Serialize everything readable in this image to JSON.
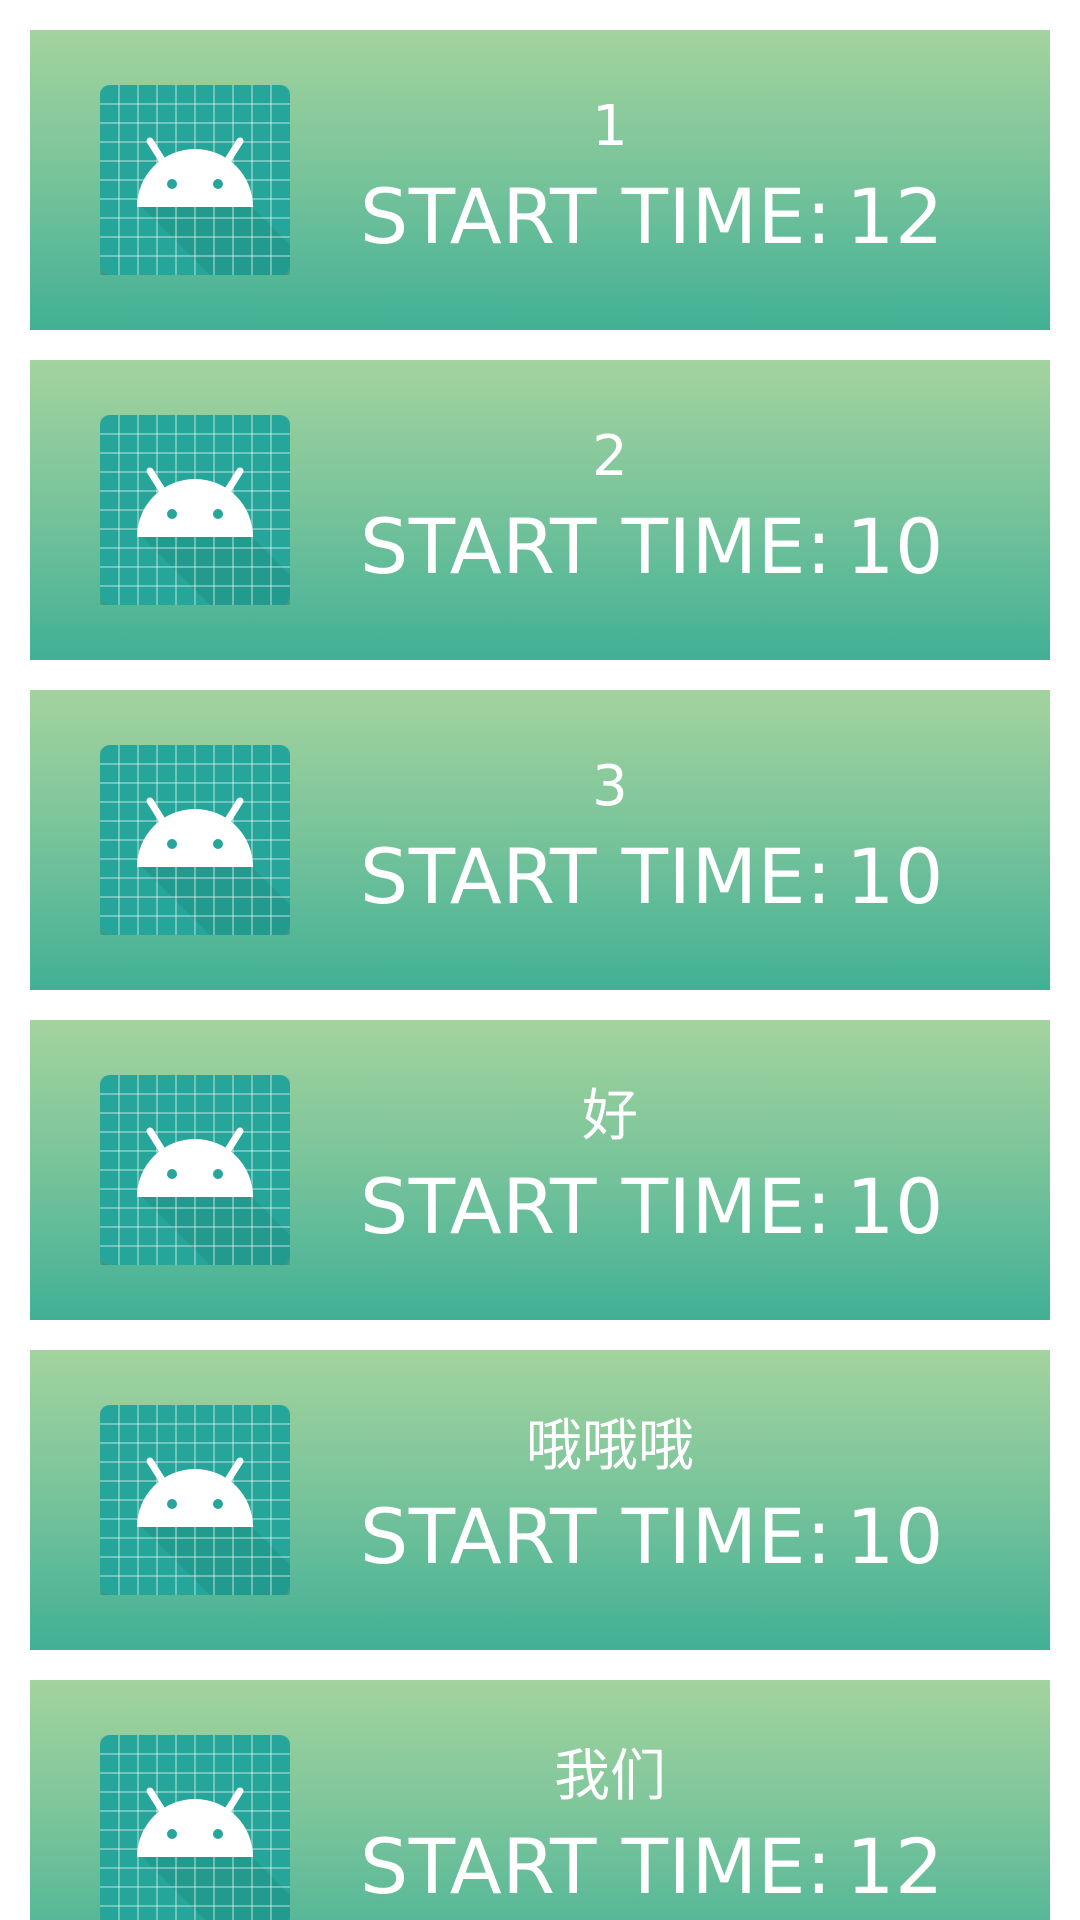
{
  "colors": {
    "card_gradient_top": "#a3d39e",
    "card_gradient_bottom": "#41b095",
    "icon_tile": "#26a69a",
    "text": "#ffffff"
  },
  "list": {
    "items": [
      {
        "title": "1",
        "start_time_label": "START TIME:",
        "start_time": "12",
        "icon": "android-icon"
      },
      {
        "title": "2",
        "start_time_label": "START TIME:",
        "start_time": "10",
        "icon": "android-icon"
      },
      {
        "title": "3",
        "start_time_label": "START TIME:",
        "start_time": "10",
        "icon": "android-icon"
      },
      {
        "title": "好",
        "start_time_label": "START TIME:",
        "start_time": "10",
        "icon": "android-icon"
      },
      {
        "title": "哦哦哦",
        "start_time_label": "START TIME:",
        "start_time": "10",
        "icon": "android-icon"
      },
      {
        "title": "我们",
        "start_time_label": "START TIME:",
        "start_time": "12",
        "icon": "android-icon"
      }
    ]
  }
}
